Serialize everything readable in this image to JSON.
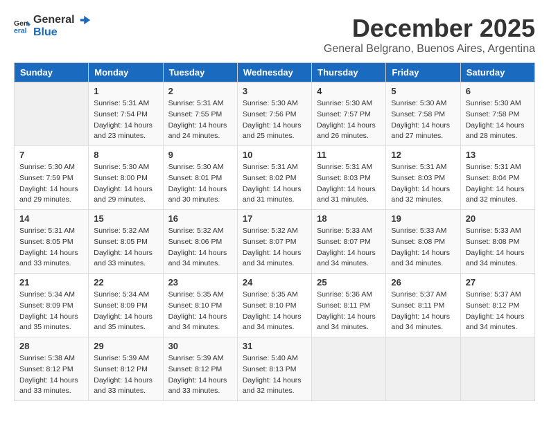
{
  "logo": {
    "text_general": "General",
    "text_blue": "Blue"
  },
  "title": "December 2025",
  "subtitle": "General Belgrano, Buenos Aires, Argentina",
  "calendar": {
    "headers": [
      "Sunday",
      "Monday",
      "Tuesday",
      "Wednesday",
      "Thursday",
      "Friday",
      "Saturday"
    ],
    "weeks": [
      [
        {
          "day": "",
          "info": ""
        },
        {
          "day": "1",
          "info": "Sunrise: 5:31 AM\nSunset: 7:54 PM\nDaylight: 14 hours\nand 23 minutes."
        },
        {
          "day": "2",
          "info": "Sunrise: 5:31 AM\nSunset: 7:55 PM\nDaylight: 14 hours\nand 24 minutes."
        },
        {
          "day": "3",
          "info": "Sunrise: 5:30 AM\nSunset: 7:56 PM\nDaylight: 14 hours\nand 25 minutes."
        },
        {
          "day": "4",
          "info": "Sunrise: 5:30 AM\nSunset: 7:57 PM\nDaylight: 14 hours\nand 26 minutes."
        },
        {
          "day": "5",
          "info": "Sunrise: 5:30 AM\nSunset: 7:58 PM\nDaylight: 14 hours\nand 27 minutes."
        },
        {
          "day": "6",
          "info": "Sunrise: 5:30 AM\nSunset: 7:58 PM\nDaylight: 14 hours\nand 28 minutes."
        }
      ],
      [
        {
          "day": "7",
          "info": "Sunrise: 5:30 AM\nSunset: 7:59 PM\nDaylight: 14 hours\nand 29 minutes."
        },
        {
          "day": "8",
          "info": "Sunrise: 5:30 AM\nSunset: 8:00 PM\nDaylight: 14 hours\nand 29 minutes."
        },
        {
          "day": "9",
          "info": "Sunrise: 5:30 AM\nSunset: 8:01 PM\nDaylight: 14 hours\nand 30 minutes."
        },
        {
          "day": "10",
          "info": "Sunrise: 5:31 AM\nSunset: 8:02 PM\nDaylight: 14 hours\nand 31 minutes."
        },
        {
          "day": "11",
          "info": "Sunrise: 5:31 AM\nSunset: 8:03 PM\nDaylight: 14 hours\nand 31 minutes."
        },
        {
          "day": "12",
          "info": "Sunrise: 5:31 AM\nSunset: 8:03 PM\nDaylight: 14 hours\nand 32 minutes."
        },
        {
          "day": "13",
          "info": "Sunrise: 5:31 AM\nSunset: 8:04 PM\nDaylight: 14 hours\nand 32 minutes."
        }
      ],
      [
        {
          "day": "14",
          "info": "Sunrise: 5:31 AM\nSunset: 8:05 PM\nDaylight: 14 hours\nand 33 minutes."
        },
        {
          "day": "15",
          "info": "Sunrise: 5:32 AM\nSunset: 8:05 PM\nDaylight: 14 hours\nand 33 minutes."
        },
        {
          "day": "16",
          "info": "Sunrise: 5:32 AM\nSunset: 8:06 PM\nDaylight: 14 hours\nand 34 minutes."
        },
        {
          "day": "17",
          "info": "Sunrise: 5:32 AM\nSunset: 8:07 PM\nDaylight: 14 hours\nand 34 minutes."
        },
        {
          "day": "18",
          "info": "Sunrise: 5:33 AM\nSunset: 8:07 PM\nDaylight: 14 hours\nand 34 minutes."
        },
        {
          "day": "19",
          "info": "Sunrise: 5:33 AM\nSunset: 8:08 PM\nDaylight: 14 hours\nand 34 minutes."
        },
        {
          "day": "20",
          "info": "Sunrise: 5:33 AM\nSunset: 8:08 PM\nDaylight: 14 hours\nand 34 minutes."
        }
      ],
      [
        {
          "day": "21",
          "info": "Sunrise: 5:34 AM\nSunset: 8:09 PM\nDaylight: 14 hours\nand 35 minutes."
        },
        {
          "day": "22",
          "info": "Sunrise: 5:34 AM\nSunset: 8:09 PM\nDaylight: 14 hours\nand 35 minutes."
        },
        {
          "day": "23",
          "info": "Sunrise: 5:35 AM\nSunset: 8:10 PM\nDaylight: 14 hours\nand 34 minutes."
        },
        {
          "day": "24",
          "info": "Sunrise: 5:35 AM\nSunset: 8:10 PM\nDaylight: 14 hours\nand 34 minutes."
        },
        {
          "day": "25",
          "info": "Sunrise: 5:36 AM\nSunset: 8:11 PM\nDaylight: 14 hours\nand 34 minutes."
        },
        {
          "day": "26",
          "info": "Sunrise: 5:37 AM\nSunset: 8:11 PM\nDaylight: 14 hours\nand 34 minutes."
        },
        {
          "day": "27",
          "info": "Sunrise: 5:37 AM\nSunset: 8:12 PM\nDaylight: 14 hours\nand 34 minutes."
        }
      ],
      [
        {
          "day": "28",
          "info": "Sunrise: 5:38 AM\nSunset: 8:12 PM\nDaylight: 14 hours\nand 33 minutes."
        },
        {
          "day": "29",
          "info": "Sunrise: 5:39 AM\nSunset: 8:12 PM\nDaylight: 14 hours\nand 33 minutes."
        },
        {
          "day": "30",
          "info": "Sunrise: 5:39 AM\nSunset: 8:12 PM\nDaylight: 14 hours\nand 33 minutes."
        },
        {
          "day": "31",
          "info": "Sunrise: 5:40 AM\nSunset: 8:13 PM\nDaylight: 14 hours\nand 32 minutes."
        },
        {
          "day": "",
          "info": ""
        },
        {
          "day": "",
          "info": ""
        },
        {
          "day": "",
          "info": ""
        }
      ]
    ]
  }
}
